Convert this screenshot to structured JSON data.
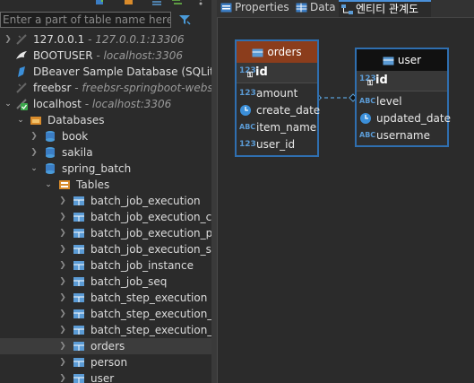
{
  "navigator": {
    "filter_placeholder": "Enter a part of table name here",
    "connections": [
      {
        "name": "127.0.0.1",
        "sub": " - 127.0.0.1:13306"
      },
      {
        "name": "BOOTUSER",
        "sub": " - localhost:3306"
      },
      {
        "name": "DBeaver Sample Database (SQLite)",
        "sub": ""
      },
      {
        "name": "freebsr",
        "sub": " - freebsr-springboot-webservice"
      },
      {
        "name": "localhost",
        "sub": " - localhost:3306"
      }
    ],
    "databases_label": "Databases",
    "schemas": [
      "book",
      "sakila",
      "spring_batch"
    ],
    "tables_label": "Tables",
    "tables": [
      "batch_job_execution",
      "batch_job_execution_context",
      "batch_job_execution_params",
      "batch_job_execution_seq",
      "batch_job_instance",
      "batch_job_seq",
      "batch_step_execution",
      "batch_step_execution_context",
      "batch_step_execution_seq",
      "orders",
      "person",
      "user"
    ]
  },
  "editor": {
    "tabs": [
      {
        "label": "Properties",
        "active": false
      },
      {
        "label": "Data",
        "active": false
      },
      {
        "label": "엔티티 관계도",
        "active": true
      }
    ]
  },
  "diagram": {
    "orders": {
      "title": "orders",
      "pk": "id",
      "fields": [
        {
          "type": "123",
          "name": "amount"
        },
        {
          "type": "clock",
          "name": "create_date"
        },
        {
          "type": "ABC",
          "name": "item_name"
        },
        {
          "type": "123",
          "name": "user_id"
        }
      ]
    },
    "user": {
      "title": "user",
      "pk": "id",
      "fields": [
        {
          "type": "ABC",
          "name": "level"
        },
        {
          "type": "clock",
          "name": "updated_date"
        },
        {
          "type": "ABC",
          "name": "username"
        }
      ]
    }
  },
  "colors": {
    "orders_header": "#8b3d1c",
    "user_header": "#111111",
    "entity_border": "#2f6fb0",
    "accent": "#4a90d9"
  }
}
